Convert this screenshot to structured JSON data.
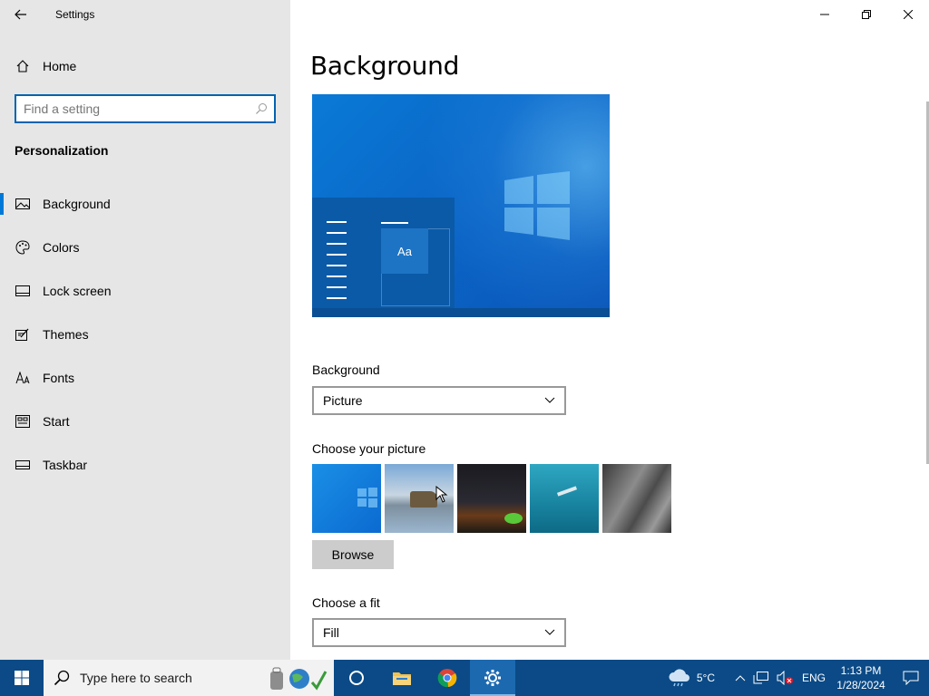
{
  "window": {
    "title": "Settings",
    "controls": [
      "minimize",
      "restore",
      "close"
    ]
  },
  "sidebar": {
    "home_label": "Home",
    "search_placeholder": "Find a setting",
    "section_title": "Personalization",
    "items": [
      {
        "label": "Background",
        "icon": "picture-icon",
        "active": true
      },
      {
        "label": "Colors",
        "icon": "palette-icon",
        "active": false
      },
      {
        "label": "Lock screen",
        "icon": "lock-screen-icon",
        "active": false
      },
      {
        "label": "Themes",
        "icon": "themes-icon",
        "active": false
      },
      {
        "label": "Fonts",
        "icon": "fonts-icon",
        "active": false
      },
      {
        "label": "Start",
        "icon": "start-icon",
        "active": false
      },
      {
        "label": "Taskbar",
        "icon": "taskbar-icon",
        "active": false
      }
    ]
  },
  "main": {
    "page_title": "Background",
    "preview_tile_text": "Aa",
    "background_label": "Background",
    "background_value": "Picture",
    "choose_picture_label": "Choose your picture",
    "pictures": [
      "windows-light-wallpaper",
      "beach-rock-wallpaper",
      "night-sky-tent-wallpaper",
      "underwater-swimmer-wallpaper",
      "rock-cliff-wallpaper"
    ],
    "browse_label": "Browse",
    "fit_label": "Choose a fit",
    "fit_value": "Fill"
  },
  "taskbar": {
    "search_hint": "Type here to search",
    "apps": [
      "cortana-icon",
      "file-explorer-icon",
      "chrome-icon",
      "settings-icon"
    ],
    "active_app": "settings-icon",
    "weather_temp": "5°C",
    "language": "ENG",
    "time": "1:13 PM",
    "date": "1/28/2024"
  },
  "colors": {
    "accent": "#0078d7",
    "sidebar_bg": "#e6e6e6",
    "taskbar_bg": "#0b4a86"
  }
}
